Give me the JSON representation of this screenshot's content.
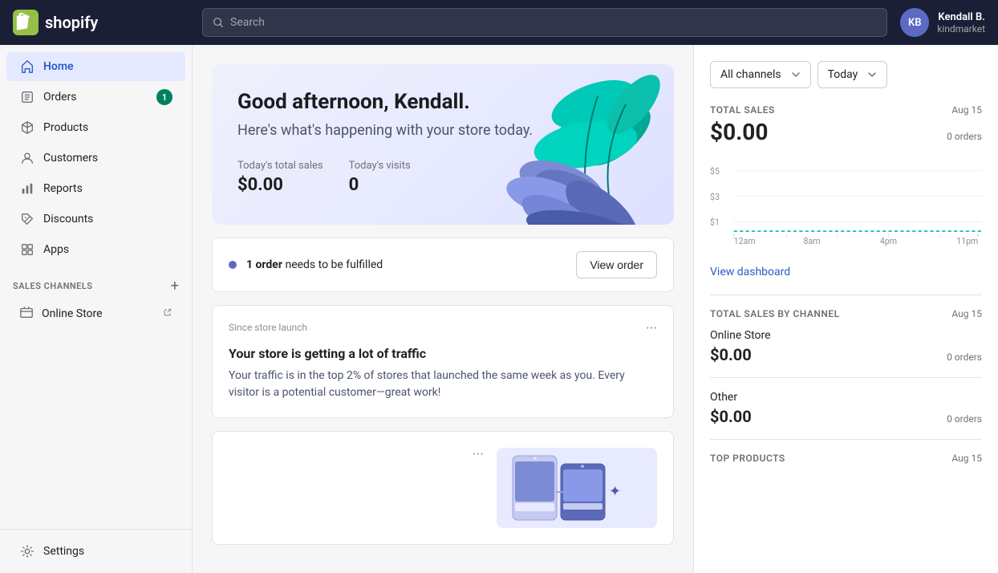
{
  "header": {
    "logo_text": "shopify",
    "search_placeholder": "Search",
    "user_initials": "KB",
    "user_name": "Kendall B.",
    "user_store": "kindmarket"
  },
  "sidebar": {
    "nav_items": [
      {
        "id": "home",
        "label": "Home",
        "active": true,
        "badge": null
      },
      {
        "id": "orders",
        "label": "Orders",
        "active": false,
        "badge": "1"
      },
      {
        "id": "products",
        "label": "Products",
        "active": false,
        "badge": null
      },
      {
        "id": "customers",
        "label": "Customers",
        "active": false,
        "badge": null
      },
      {
        "id": "reports",
        "label": "Reports",
        "active": false,
        "badge": null
      },
      {
        "id": "discounts",
        "label": "Discounts",
        "active": false,
        "badge": null
      },
      {
        "id": "apps",
        "label": "Apps",
        "active": false,
        "badge": null
      }
    ],
    "sales_channels_title": "SALES CHANNELS",
    "online_store_label": "Online Store",
    "settings_label": "Settings"
  },
  "main": {
    "greeting": "Good afternoon, Kendall.",
    "subtitle": "Here's what's happening with your store today.",
    "todays_total_sales_label": "Today's total sales",
    "todays_total_sales_value": "$0.00",
    "todays_visits_label": "Today's visits",
    "todays_visits_value": "0",
    "alert_text_bold": "1 order",
    "alert_text_rest": " needs to be fulfilled",
    "view_order_button": "View order",
    "card1_since": "Since store launch",
    "card1_title": "Your store is getting a lot of traffic",
    "card1_body": "Your traffic is in the top 2% of stores that launched the same week as you. Every visitor is a potential customer—great work!"
  },
  "right_panel": {
    "channel_filter_label": "All channels",
    "time_filter_label": "Today",
    "total_sales_label": "TOTAL SALES",
    "total_sales_date": "Aug 15",
    "total_sales_value": "$0.00",
    "total_sales_orders": "0 orders",
    "chart_y_labels": [
      "$5",
      "$3",
      "$1"
    ],
    "chart_x_labels": [
      "12am",
      "8am",
      "4pm",
      "11pm"
    ],
    "view_dashboard_label": "View dashboard",
    "by_channel_label": "TOTAL SALES BY CHANNEL",
    "by_channel_date": "Aug 15",
    "online_store_label": "Online Store",
    "online_store_value": "$0.00",
    "online_store_orders": "0 orders",
    "other_label": "Other",
    "other_value": "$0.00",
    "other_orders": "0 orders",
    "top_products_label": "TOP PRODUCTS",
    "top_products_date": "Aug 15"
  }
}
